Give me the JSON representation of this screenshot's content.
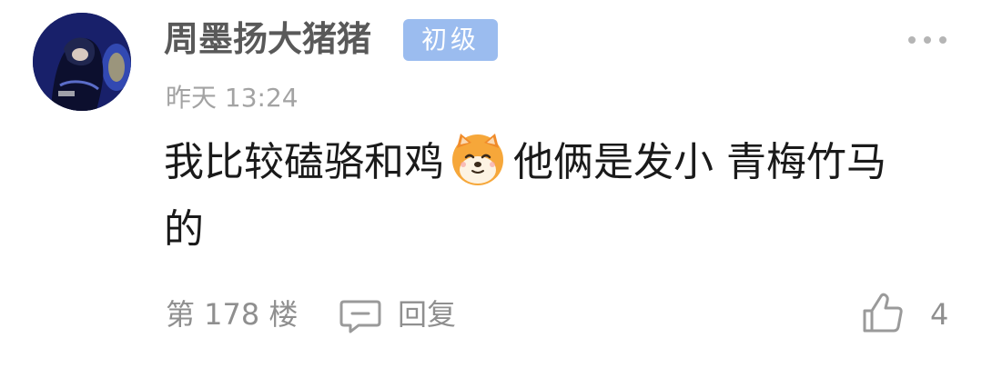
{
  "comment": {
    "username": "周墨扬大猪猪",
    "level_badge": "初级",
    "timestamp": "昨天 13:24",
    "content_line1_before_emoji": "我比较磕骆和鸡",
    "emoji_icon": "shiba-dog-emoji-icon",
    "content_line1_after_emoji": "他俩是发小 青梅竹马",
    "content_line2": "的",
    "floor": "第 178 楼",
    "reply_label": "回复",
    "like_count": "4"
  },
  "colors": {
    "badge": "#9bbcef",
    "username": "#595959",
    "meta": "#a3a3a3",
    "body_text": "#1a1a1a"
  }
}
